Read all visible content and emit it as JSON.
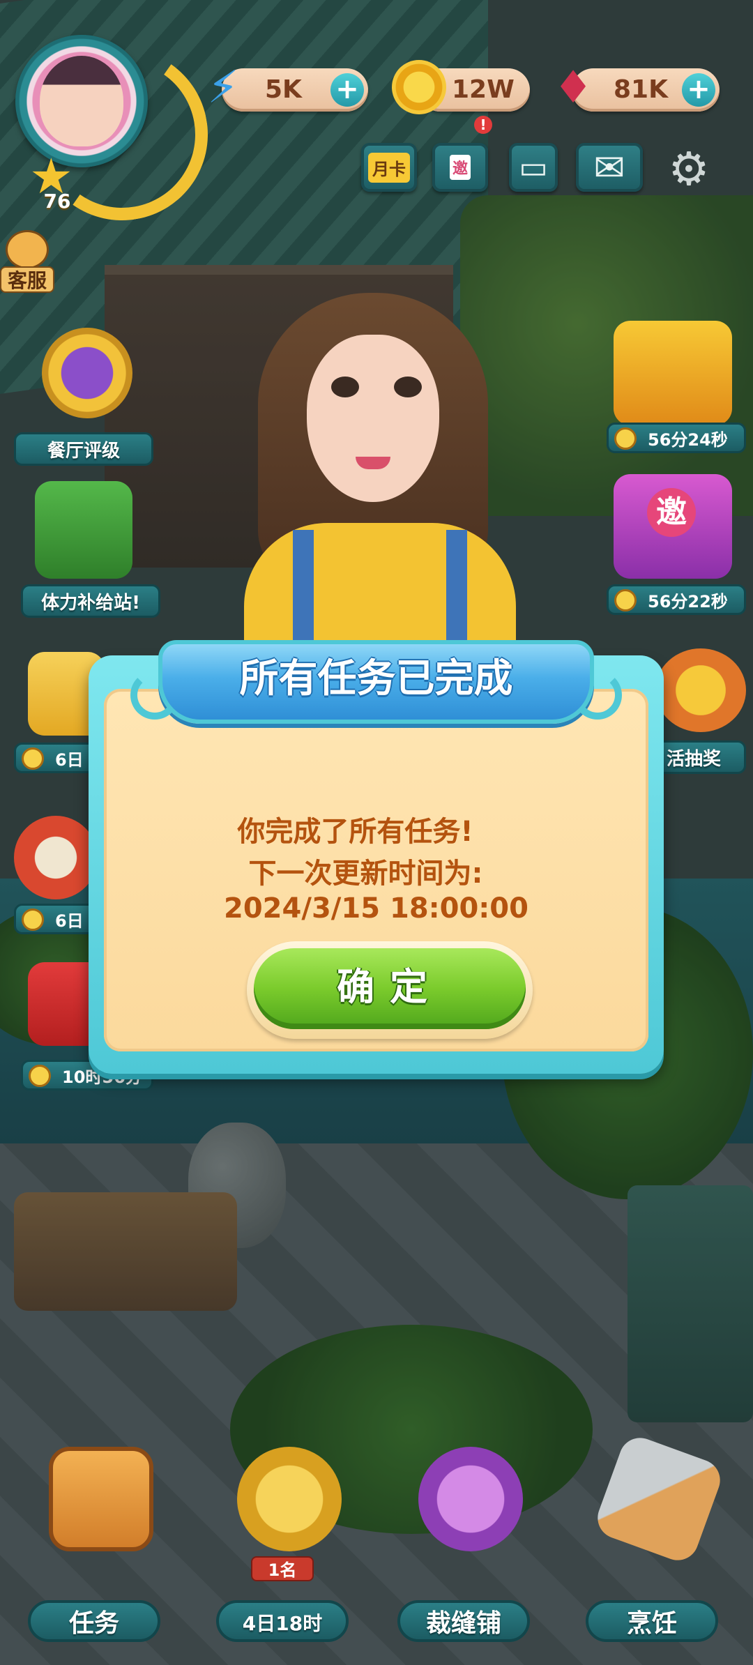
{
  "hud": {
    "level": "76",
    "energy": "5K",
    "coins": "12W",
    "gems": "81K",
    "plus": "+",
    "month_card": "月卡",
    "invite": "邀",
    "notification": "!",
    "customer_service": "客服"
  },
  "left_features": [
    {
      "label": "餐厅评级"
    },
    {
      "label": "体力补给站!"
    },
    {
      "timer": "6日"
    },
    {
      "timer": "6日"
    },
    {
      "timer": "10时56分"
    }
  ],
  "right_features": [
    {
      "timer": "56分24秒"
    },
    {
      "badge": "邀",
      "timer": "56分22秒"
    },
    {
      "label": "活抽奖"
    }
  ],
  "modal": {
    "title": "所有任务已完成",
    "line1": "你完成了所有任务!",
    "line2": "下一次更新时间为:",
    "line3": "2024/3/15 18:00:00",
    "confirm_label": "确定"
  },
  "bottom_nav": [
    {
      "label": "任务"
    },
    {
      "label": "4日18时",
      "badge": "1名"
    },
    {
      "label": "裁缝铺"
    },
    {
      "label": "烹饪"
    }
  ]
}
